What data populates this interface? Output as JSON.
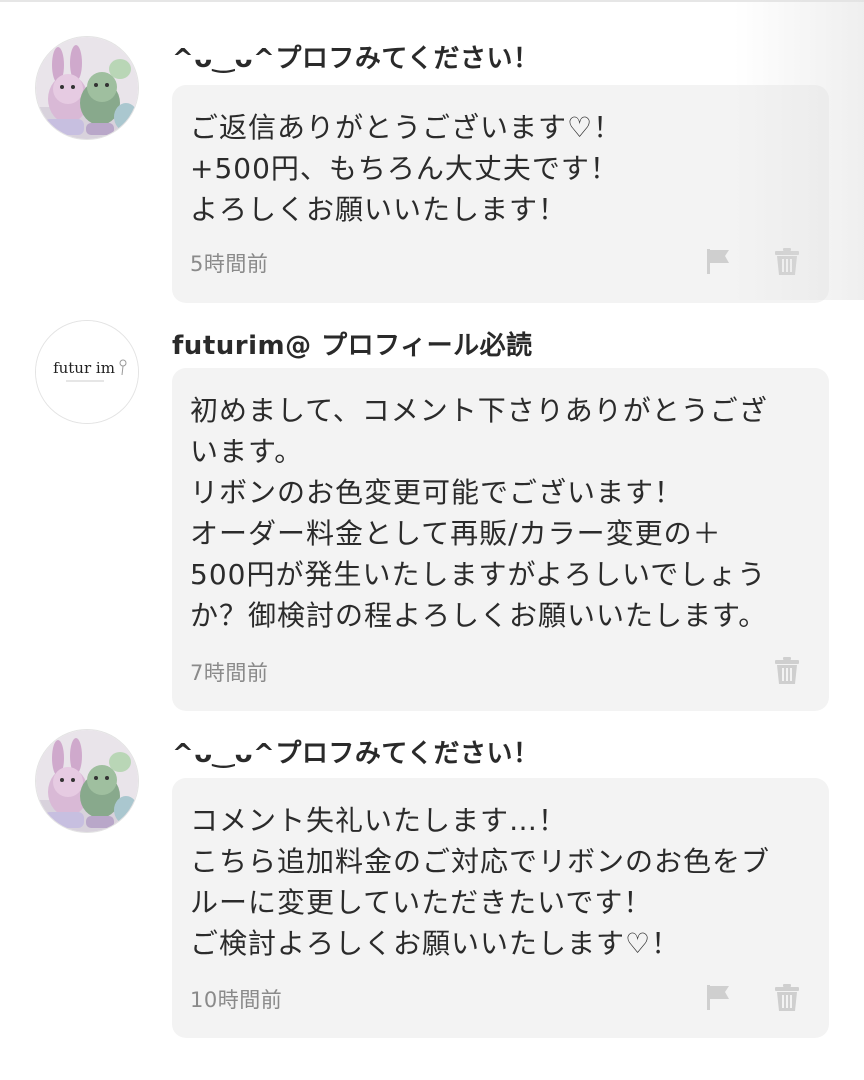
{
  "comments": [
    {
      "username": "^ᴗ‿ᴗ^プロフみてください！",
      "message": "ご返信ありがとうございます♡！\n+500円、もちろん大丈夫です！\nよろしくお願いいたします！",
      "time": "5時間前",
      "avatar_icon": "plush-toys-avatar",
      "actions": [
        "flag-icon",
        "trash-icon"
      ]
    },
    {
      "username": "futurim@ プロフィール必読",
      "message": "初めまして、コメント下さりありがとうござ\nいます。\nリボンのお色変更可能でございます！\nオーダー料金として再販/カラー変更の＋\n500円が発生いたしますがよろしいでしょう\nか？御検討の程よろしくお願いいたします。",
      "time": "7時間前",
      "avatar_logo_text": "futur im",
      "avatar_icon": "futurim-logo-avatar",
      "actions": [
        "trash-icon"
      ]
    },
    {
      "username": "^ᴗ‿ᴗ^プロフみてください！",
      "message": "コメント失礼いたします…！\nこちら追加料金のご対応でリボンのお色をブ\nルーに変更していただきたいです！\nご検討よろしくお願いいたします♡！",
      "time": "10時間前",
      "avatar_icon": "plush-toys-avatar",
      "actions": [
        "flag-icon",
        "trash-icon"
      ]
    }
  ],
  "colors": {
    "bubble_bg": "#f3f3f3",
    "icon_gray": "#cfcfcf",
    "time_gray": "#8a8a8a"
  }
}
